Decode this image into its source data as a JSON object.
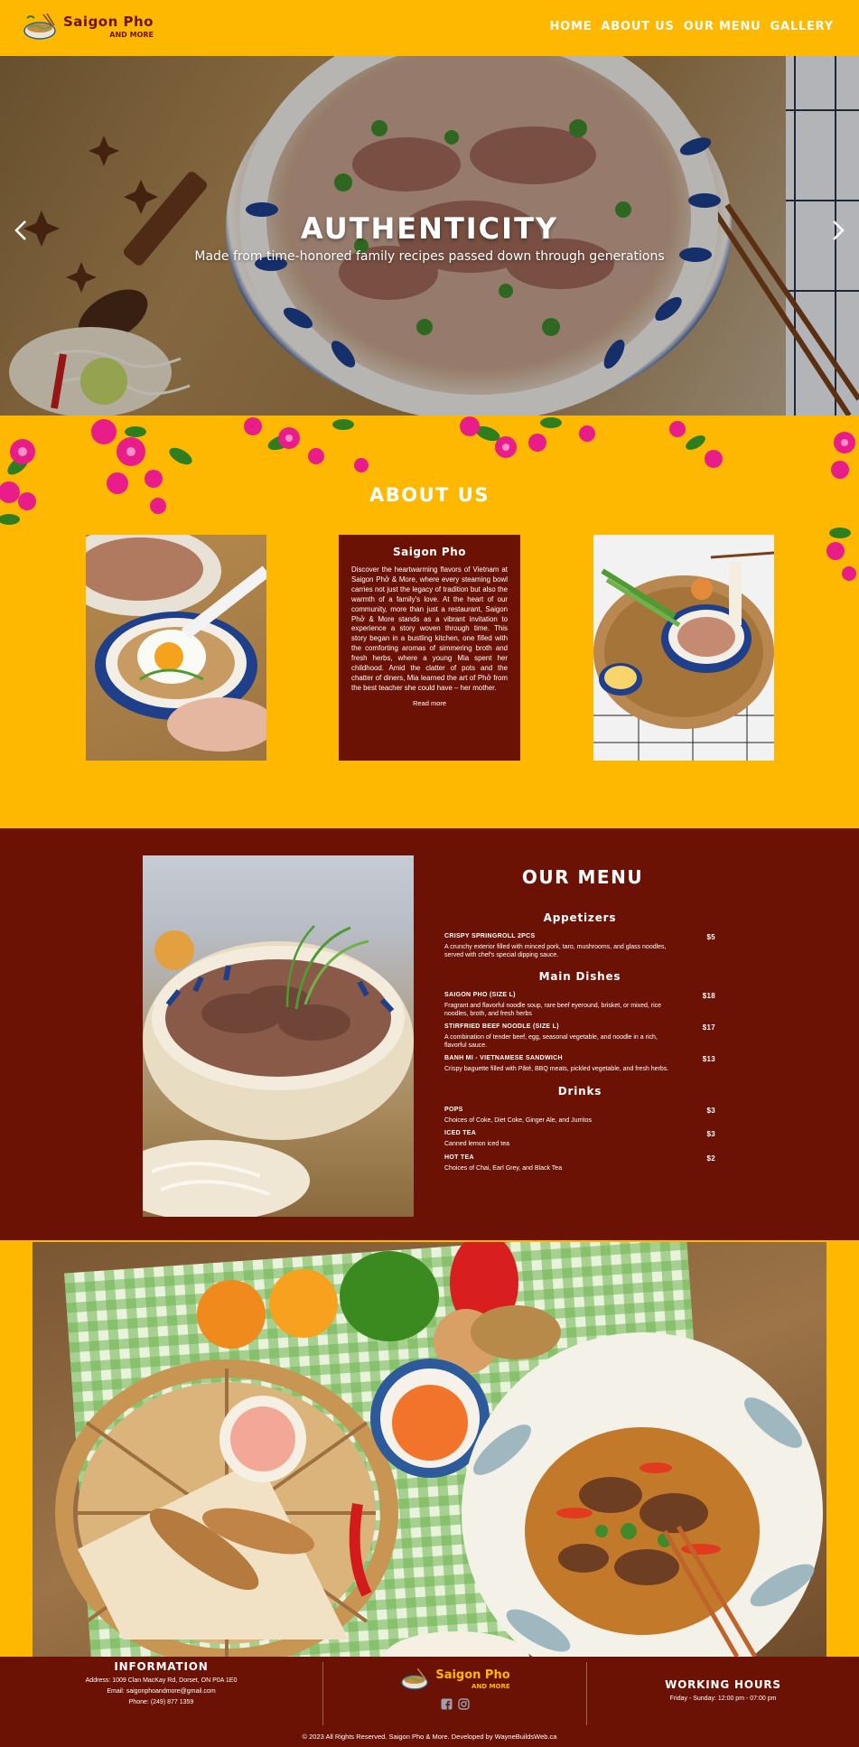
{
  "brand": {
    "name": "Saigon Pho",
    "sub": "AND MORE"
  },
  "nav": {
    "items": [
      "HOME",
      "ABOUT US",
      "OUR MENU",
      "GALLERY"
    ]
  },
  "hero": {
    "title": "AUTHENTICITY",
    "subtitle": "Made from time-honored family recipes passed down through generations",
    "prev": "‹",
    "next": "›"
  },
  "about": {
    "title": "ABOUT US",
    "card_title": "Saigon Pho",
    "card_text": "Discover the heartwarming flavors of Vietnam at Saigon Phở & More, where every steaming bowl carries not just the legacy of tradition but also the warmth of a family's love. At the heart of our community, more than just a restaurant, Saigon Phở & More stands as a vibrant invitation to experience a story woven through time. This story began in a bustling kitchen, one filled with the comforting aromas of simmering broth and fresh herbs, where a young Mia spent her childhood. Amid the clatter of pots and the chatter of diners, Mia learned the art of Phở from the best teacher she could have – her mother.",
    "read_more": "Read more"
  },
  "menu": {
    "title": "OUR MENU",
    "categories": [
      {
        "name": "Appetizers",
        "items": [
          {
            "name": "CRISPY SPRINGROLL 2PCS",
            "price": "$5",
            "desc": "A crunchy exterior filled with minced pork, taro, mushrooms, and glass noodles, served with chef's special dipping sauce."
          }
        ]
      },
      {
        "name": "Main Dishes",
        "items": [
          {
            "name": "SAIGON PHO (SIZE L)",
            "price": "$18",
            "desc": "Fragrant and flavorful noodle soup, rare beef eyeround, brisket, or mixed, rice noodles, broth, and fresh herbs"
          },
          {
            "name": "STIRFRIED BEEF NOODLE (SIZE L)",
            "price": "$17",
            "desc": "A combination of tender beef, egg, seasonal vegetable, and noodle in a rich, flavorful sauce."
          },
          {
            "name": "BANH MI - VIETNAMESE SANDWICH",
            "price": "$13",
            "desc": "Crispy baguette filled with Pâté, BBQ meats, pickled vegetable, and fresh herbs."
          }
        ]
      },
      {
        "name": "Drinks",
        "items": [
          {
            "name": "POPS",
            "price": "$3",
            "desc": "Choices of Coke, Diet Coke, Ginger Ale, and Jurritos"
          },
          {
            "name": "ICED TEA",
            "price": "$3",
            "desc": "Canned lemon iced tea"
          },
          {
            "name": "HOT TEA",
            "price": "$2",
            "desc": "Choices of Chai, Earl Grey, and Black Tea"
          }
        ]
      }
    ]
  },
  "footer": {
    "info_title": "INFORMATION",
    "address": "Address: 1009 Clan MacKay Rd, Dorset, ON P0A 1E0",
    "email": "Email: saigonphoandmore@gmail.com",
    "phone": "Phone: (249) 877 1359",
    "hours_title": "WORKING HOURS",
    "hours": "Friday - Sunday: 12:00 pm - 07:00 pm",
    "copyright": "© 2023 All Rights Reserved. Saigon Pho & More. Developed by WayneBuildsWeb.ca",
    "social": [
      "facebook-icon",
      "instagram-icon"
    ]
  },
  "colors": {
    "gold": "#FFB800",
    "maroon": "#6B1205",
    "white": "#FFFFFF"
  }
}
